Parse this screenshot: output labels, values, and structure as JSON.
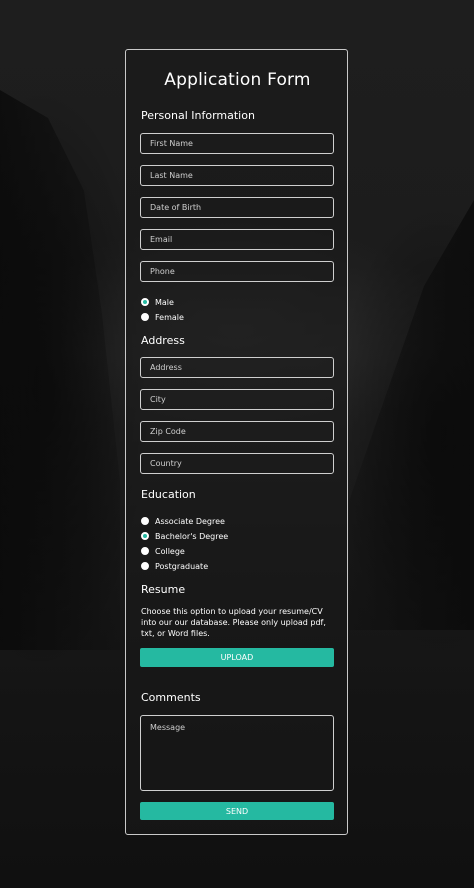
{
  "form": {
    "title": "Application Form",
    "personal": {
      "heading": "Personal Information",
      "first_name_placeholder": "First Name",
      "last_name_placeholder": "Last Name",
      "dob_placeholder": "Date of Birth",
      "email_placeholder": "Email",
      "phone_placeholder": "Phone"
    },
    "gender": {
      "options": [
        {
          "label": "Male",
          "checked": true
        },
        {
          "label": "Female",
          "checked": false
        }
      ]
    },
    "address": {
      "heading": "Address",
      "address_placeholder": "Address",
      "city_placeholder": "City",
      "zip_placeholder": "Zip Code",
      "country_placeholder": "Country"
    },
    "education": {
      "heading": "Education",
      "options": [
        {
          "label": "Associate Degree",
          "checked": false
        },
        {
          "label": "Bachelor's Degree",
          "checked": true
        },
        {
          "label": "College",
          "checked": false
        },
        {
          "label": "Postgraduate",
          "checked": false
        }
      ]
    },
    "resume": {
      "heading": "Resume",
      "description": "Choose this option to upload your resume/CV into our our database. Please only upload pdf, txt, or Word files.",
      "upload_label": "UPLOAD"
    },
    "comments": {
      "heading": "Comments",
      "message_placeholder": "Message"
    },
    "send_label": "SEND"
  },
  "colors": {
    "accent": "#25b9a1",
    "border": "#cfcfcf",
    "text": "#ffffff"
  }
}
